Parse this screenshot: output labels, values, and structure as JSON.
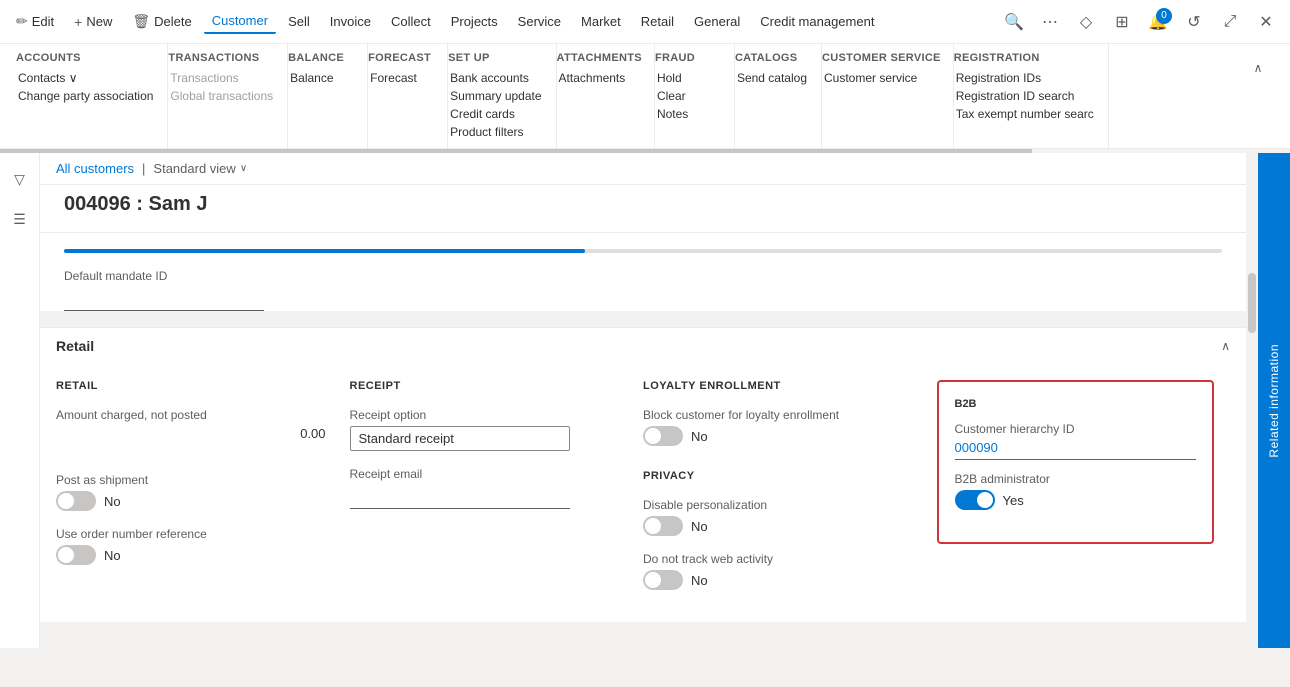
{
  "topNav": {
    "items": [
      {
        "id": "edit",
        "label": "Edit",
        "icon": "✏️",
        "active": false
      },
      {
        "id": "new",
        "label": "New",
        "icon": "+",
        "active": false
      },
      {
        "id": "delete",
        "label": "Delete",
        "icon": "🗑",
        "active": false
      },
      {
        "id": "customer",
        "label": "Customer",
        "active": true
      },
      {
        "id": "sell",
        "label": "Sell",
        "active": false
      },
      {
        "id": "invoice",
        "label": "Invoice",
        "active": false
      },
      {
        "id": "collect",
        "label": "Collect",
        "active": false
      },
      {
        "id": "projects",
        "label": "Projects",
        "active": false
      },
      {
        "id": "service",
        "label": "Service",
        "active": false
      },
      {
        "id": "market",
        "label": "Market",
        "active": false
      },
      {
        "id": "retail",
        "label": "Retail",
        "active": false
      },
      {
        "id": "general",
        "label": "General",
        "active": false
      },
      {
        "id": "credit",
        "label": "Credit management",
        "active": false
      }
    ],
    "rightIcons": [
      {
        "id": "search",
        "symbol": "🔍"
      },
      {
        "id": "more",
        "symbol": "⋯"
      },
      {
        "id": "diamond",
        "symbol": "◇"
      },
      {
        "id": "layout",
        "symbol": "⊞"
      },
      {
        "id": "notify",
        "symbol": "🔔",
        "badge": "0"
      },
      {
        "id": "refresh",
        "symbol": "↺"
      },
      {
        "id": "undock",
        "symbol": "⤢"
      },
      {
        "id": "close",
        "symbol": "✕"
      }
    ]
  },
  "ribbon": {
    "groups": [
      {
        "id": "accounts",
        "title": "Accounts",
        "items": [
          {
            "id": "contacts",
            "label": "Contacts ∨",
            "type": "normal"
          },
          {
            "id": "change-party",
            "label": "Change party association",
            "type": "normal"
          }
        ]
      },
      {
        "id": "transactions",
        "title": "Transactions",
        "items": [
          {
            "id": "transactions",
            "label": "Transactions",
            "type": "disabled"
          },
          {
            "id": "global-transactions",
            "label": "Global transactions",
            "type": "disabled"
          }
        ]
      },
      {
        "id": "balance",
        "title": "Balance",
        "items": [
          {
            "id": "balance",
            "label": "Balance",
            "type": "normal"
          }
        ]
      },
      {
        "id": "forecast",
        "title": "Forecast",
        "items": [
          {
            "id": "forecast",
            "label": "Forecast",
            "type": "normal"
          }
        ]
      },
      {
        "id": "setup",
        "title": "Set up",
        "items": [
          {
            "id": "bank-accounts",
            "label": "Bank accounts",
            "type": "normal"
          },
          {
            "id": "summary-update",
            "label": "Summary update",
            "type": "normal"
          },
          {
            "id": "credit-cards",
            "label": "Credit cards",
            "type": "normal"
          },
          {
            "id": "product-filters",
            "label": "Product filters",
            "type": "normal"
          }
        ]
      },
      {
        "id": "attachments",
        "title": "Attachments",
        "items": [
          {
            "id": "attachments",
            "label": "Attachments",
            "type": "normal"
          }
        ]
      },
      {
        "id": "fraud",
        "title": "Fraud",
        "items": [
          {
            "id": "hold",
            "label": "Hold",
            "type": "normal"
          },
          {
            "id": "clear",
            "label": "Clear",
            "type": "normal"
          },
          {
            "id": "notes",
            "label": "Notes",
            "type": "normal"
          }
        ]
      },
      {
        "id": "catalogs",
        "title": "Catalogs",
        "items": [
          {
            "id": "send-catalog",
            "label": "Send catalog",
            "type": "normal"
          }
        ]
      },
      {
        "id": "customer-service",
        "title": "Customer service",
        "items": [
          {
            "id": "customer-service",
            "label": "Customer service",
            "type": "normal"
          }
        ]
      },
      {
        "id": "registration",
        "title": "Registration",
        "items": [
          {
            "id": "registration-ids",
            "label": "Registration IDs",
            "type": "normal"
          },
          {
            "id": "registration-id-search",
            "label": "Registration ID search",
            "type": "normal"
          },
          {
            "id": "tax-exempt",
            "label": "Tax exempt number searc",
            "type": "normal"
          }
        ]
      }
    ]
  },
  "breadcrumb": {
    "parent": "All customers",
    "view": "Standard view"
  },
  "pageTitle": "004096 : Sam J",
  "defaultMandateLabel": "Default mandate ID",
  "retailSection": {
    "title": "Retail",
    "retail": {
      "title": "RETAIL",
      "amountLabel": "Amount charged, not posted",
      "amountValue": "0.00",
      "postLabel": "Post as shipment",
      "postToggle": "off",
      "postToggleLabel": "No",
      "orderRefLabel": "Use order number reference",
      "orderRefToggle": "off",
      "orderRefLabel2": "No"
    },
    "receipt": {
      "title": "RECEIPT",
      "optionLabel": "Receipt option",
      "optionValue": "Standard receipt",
      "emailLabel": "Receipt email",
      "emailValue": ""
    },
    "loyalty": {
      "title": "LOYALTY ENROLLMENT",
      "blockLabel": "Block customer for loyalty enrollment",
      "blockToggle": "off",
      "blockToggleLabel": "No"
    },
    "privacy": {
      "title": "PRIVACY",
      "disableLabel": "Disable personalization",
      "disableToggle": "off",
      "disableToggleLabel": "No",
      "trackLabel": "Do not track web activity",
      "trackToggle": "off",
      "trackToggleLabel": "No"
    },
    "b2b": {
      "title": "B2B",
      "hierarchyLabel": "Customer hierarchy ID",
      "hierarchyValue": "000090",
      "adminLabel": "B2B administrator",
      "adminToggle": "on",
      "adminToggleLabel": "Yes"
    }
  },
  "rightPanel": {
    "label": "Related information"
  }
}
